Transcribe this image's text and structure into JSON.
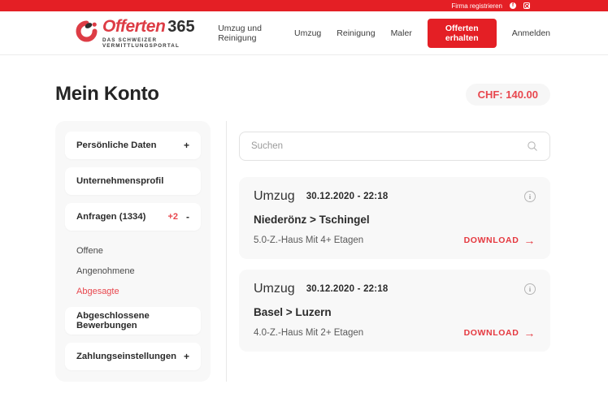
{
  "topbar": {
    "register_label": "Firma registrieren"
  },
  "header": {
    "logo": {
      "brand": "Offerten",
      "brand_suffix": "365",
      "tagline": "DAS SCHWEIZER VERMITTLUNGSPORTAL"
    },
    "nav": [
      {
        "label": "Umzug und Reinigung"
      },
      {
        "label": "Umzug"
      },
      {
        "label": "Reinigung"
      },
      {
        "label": "Maler"
      }
    ],
    "cta_label": "Offerten erhalten",
    "login_label": "Anmelden"
  },
  "page": {
    "title": "Mein Konto",
    "balance": "CHF: 140.00"
  },
  "sidebar": {
    "items": [
      {
        "label": "Persönliche Daten",
        "badge": "",
        "toggle": "+"
      },
      {
        "label": "Unternehmensprofil",
        "badge": "",
        "toggle": ""
      },
      {
        "label": "Anfragen (1334)",
        "badge": "+2",
        "toggle": "-"
      },
      {
        "label": "Abgeschlossene Bewerbungen",
        "badge": "",
        "toggle": ""
      },
      {
        "label": "Zahlungseinstellungen",
        "badge": "",
        "toggle": "+"
      }
    ],
    "submenu": [
      {
        "label": "Offene"
      },
      {
        "label": "Angenohmene"
      },
      {
        "label": "Abgesagte"
      }
    ]
  },
  "search": {
    "placeholder": "Suchen"
  },
  "requests": [
    {
      "type": "Umzug",
      "datetime": "30.12.2020 - 22:18",
      "route": "Niederönz > Tschingel",
      "details": "5.0-Z.-Haus Mit 4+ Etagen",
      "action": "DOWNLOAD"
    },
    {
      "type": "Umzug",
      "datetime": "30.12.2020 - 22:18",
      "route": "Basel > Luzern",
      "details": "4.0-Z.-Haus Mit 2+ Etagen",
      "action": "DOWNLOAD"
    }
  ],
  "colors": {
    "topbar_red": "#e41f25",
    "accent_red": "#e8474e",
    "logo_red": "#dd3c45",
    "card_bg": "#f8f8f8"
  }
}
